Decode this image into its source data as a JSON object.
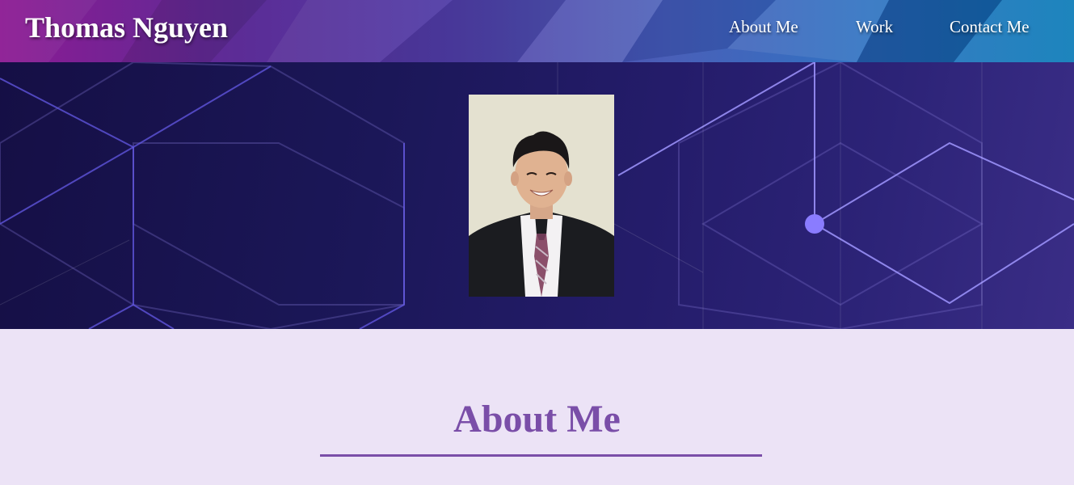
{
  "header": {
    "brand": "Thomas Nguyen",
    "nav": [
      {
        "label": "About Me"
      },
      {
        "label": "Work"
      },
      {
        "label": "Contact Me"
      }
    ]
  },
  "hero": {
    "photo_subject": "portrait of man in black suit, white shirt and plaid tie"
  },
  "about": {
    "title": "About Me"
  },
  "colors": {
    "accent": "#7a4ea8",
    "page_background": "#ece3f6",
    "hero_dark": "#1b1758"
  }
}
